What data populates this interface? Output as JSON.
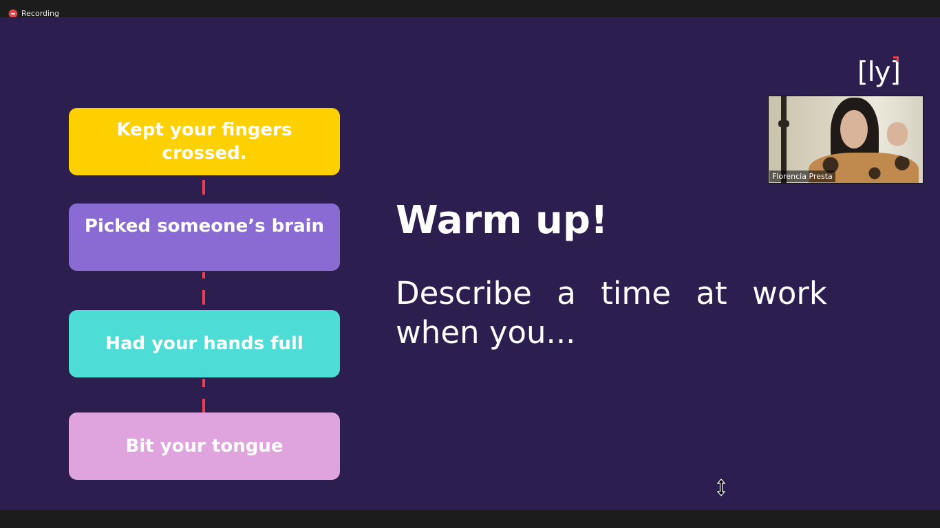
{
  "recording": {
    "label": "Recording"
  },
  "slide": {
    "cards": [
      {
        "text": "Kept your fingers crossed.",
        "color": "#ffd000"
      },
      {
        "text": "Picked someone’s brain",
        "color": "#8a6bd4"
      },
      {
        "text": "Had your hands full",
        "color": "#4ddcd6"
      },
      {
        "text": "Bit your tongue",
        "color": "#dfa3de"
      }
    ],
    "title": "Warm up!",
    "body": "Describe a time at work when you...",
    "logo": "[ly]",
    "accent_color": "#ef3e4f",
    "background_color": "#2d1e50"
  },
  "video": {
    "participant_name": "Florencia Presta"
  }
}
